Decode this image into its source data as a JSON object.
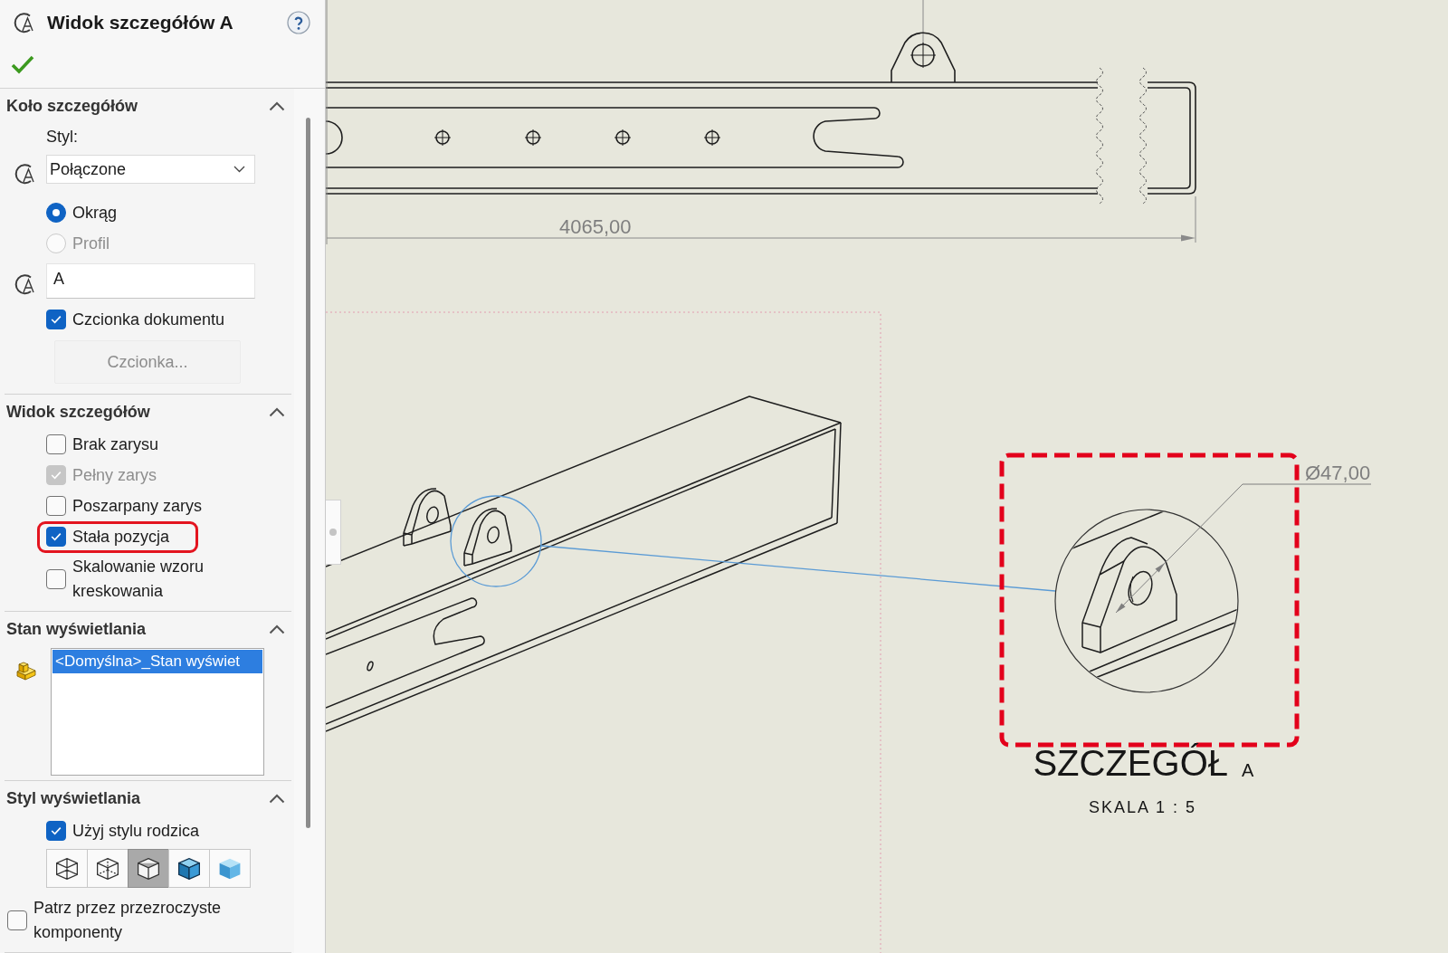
{
  "panel": {
    "title": "Widok szczegółów A"
  },
  "sections": [
    {
      "title": "Koło szczegółów",
      "expanded": true,
      "items": [
        {
          "kind": "label",
          "text": "Styl:"
        },
        {
          "kind": "dropdown",
          "value": "Połączone"
        },
        {
          "kind": "radio",
          "label": "Okrąg",
          "selected": true,
          "disabled": false
        },
        {
          "kind": "radio",
          "label": "Profil",
          "selected": false,
          "disabled": true
        },
        {
          "kind": "text_field",
          "value": "A"
        },
        {
          "kind": "checkbox",
          "label": "Czcionka dokumentu",
          "checked": true,
          "disabled": false,
          "highlighted": false
        },
        {
          "kind": "button",
          "label": "Czcionka...",
          "disabled": true
        }
      ]
    },
    {
      "title": "Widok szczegółów",
      "expanded": true,
      "items": [
        {
          "kind": "checkbox",
          "label": "Brak zarysu",
          "checked": false,
          "disabled": false,
          "highlighted": false
        },
        {
          "kind": "checkbox",
          "label": "Pełny zarys",
          "checked": true,
          "disabled": true,
          "highlighted": false
        },
        {
          "kind": "checkbox",
          "label": "Poszarpany zarys",
          "checked": false,
          "disabled": false,
          "highlighted": false
        },
        {
          "kind": "checkbox",
          "label": "Stała pozycja",
          "checked": true,
          "disabled": false,
          "highlighted": true
        },
        {
          "kind": "checkbox",
          "label": "Skalowanie wzoru kreskowania",
          "checked": false,
          "disabled": false,
          "highlighted": false
        }
      ]
    },
    {
      "title": "Stan wyświetlania",
      "expanded": true,
      "items": [
        {
          "kind": "list",
          "entries": [
            {
              "label": "<Domyślna>_Stan wyświet",
              "selected": true
            }
          ]
        }
      ]
    },
    {
      "title": "Styl wyświetlania",
      "expanded": true,
      "items": [
        {
          "kind": "checkbox",
          "label": "Użyj stylu rodzica",
          "checked": true,
          "disabled": false,
          "highlighted": false
        },
        {
          "kind": "style_buttons",
          "buttons": [
            {
              "kind": "wireframe",
              "selected": false
            },
            {
              "kind": "hidden_visible",
              "selected": false
            },
            {
              "kind": "hidden_removed",
              "selected": true
            },
            {
              "kind": "shaded_edges",
              "selected": false
            },
            {
              "kind": "shaded",
              "selected": false
            }
          ]
        },
        {
          "kind": "flush_checkbox",
          "label": "Patrz przez przezroczyste komponenty",
          "checked": false,
          "disabled": false,
          "highlighted": false
        }
      ]
    }
  ],
  "drawing": {
    "top_view": {
      "dimension": "4065,00"
    },
    "detail_view": {
      "label": "SZCZEGÓŁ",
      "letter": "A",
      "scale": "SKALA 1 : 5",
      "dimension": "Ø47,00",
      "highlighted": true
    }
  }
}
